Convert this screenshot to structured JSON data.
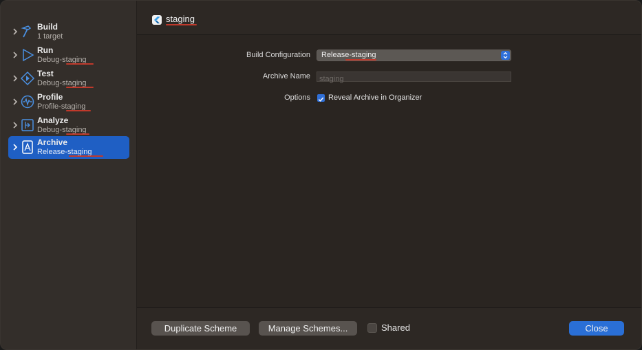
{
  "sidebar": {
    "items": [
      {
        "title": "Build",
        "subtitle": "1 target",
        "icon": "hammer-icon"
      },
      {
        "title": "Run",
        "subtitle": "Debug-staging",
        "icon": "play-icon"
      },
      {
        "title": "Test",
        "subtitle": "Debug-staging",
        "icon": "test-diamond-icon"
      },
      {
        "title": "Profile",
        "subtitle": "Profile-staging",
        "icon": "waveform-icon"
      },
      {
        "title": "Analyze",
        "subtitle": "Debug-staging",
        "icon": "analyze-icon"
      },
      {
        "title": "Archive",
        "subtitle": "Release-staging",
        "icon": "archive-icon"
      }
    ],
    "selected": "Archive"
  },
  "header": {
    "scheme_name": "staging",
    "icon": "flutter-logo-icon"
  },
  "form": {
    "build_configuration_label": "Build Configuration",
    "build_configuration_value": "Release-staging",
    "archive_name_label": "Archive Name",
    "archive_name_placeholder": "staging",
    "options_label": "Options",
    "reveal_label": "Reveal Archive in Organizer",
    "reveal_checked": true
  },
  "footer": {
    "duplicate_label": "Duplicate Scheme",
    "manage_label": "Manage Schemes...",
    "shared_label": "Shared",
    "shared_checked": false,
    "close_label": "Close"
  },
  "colors": {
    "accent": "#2a6fd6",
    "selection": "#1f5fc4",
    "spellcheck": "#c0392b"
  }
}
